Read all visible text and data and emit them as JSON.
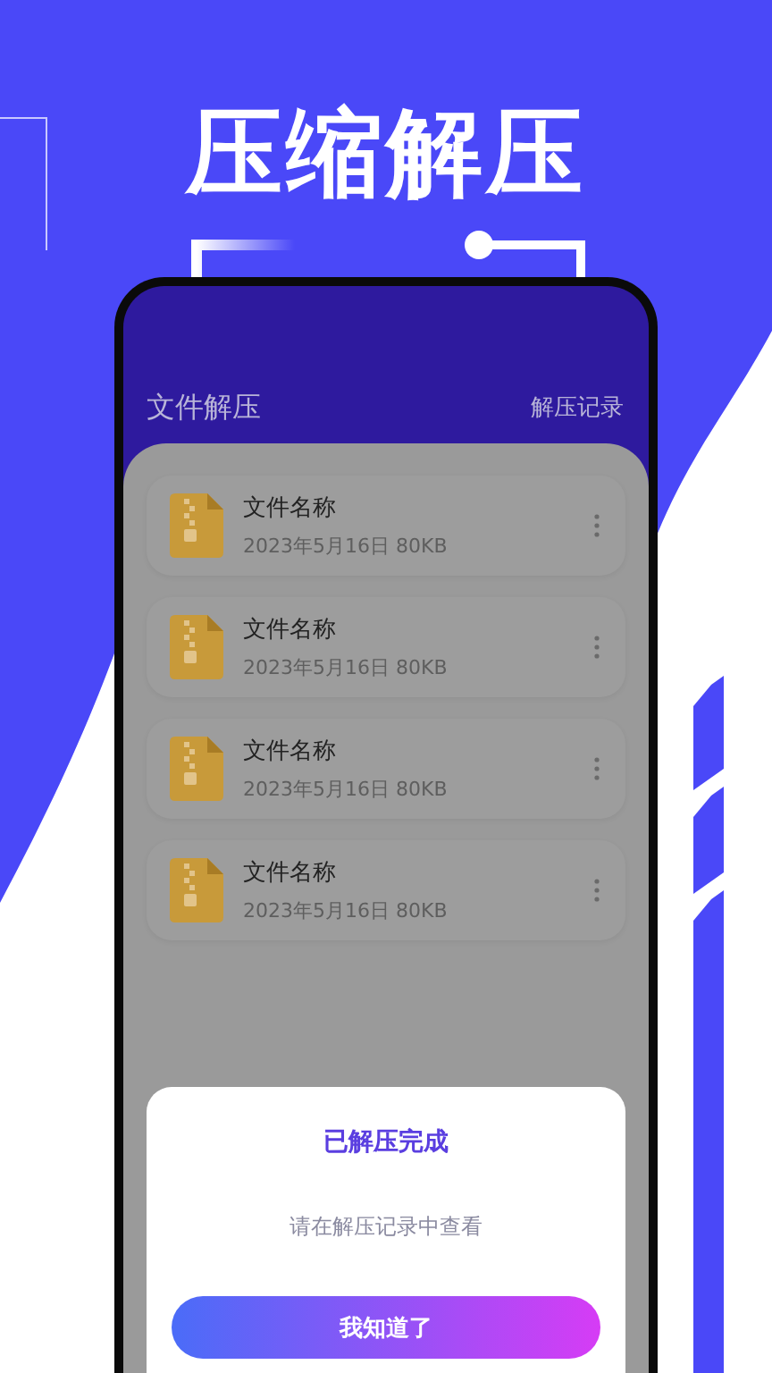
{
  "headline": "压缩解压",
  "app": {
    "title": "文件解压",
    "action": "解压记录",
    "files": [
      {
        "name": "文件名称",
        "date": "2023年5月16日",
        "size": "80KB"
      },
      {
        "name": "文件名称",
        "date": "2023年5月16日",
        "size": "80KB"
      },
      {
        "name": "文件名称",
        "date": "2023年5月16日",
        "size": "80KB"
      },
      {
        "name": "文件名称",
        "date": "2023年5月16日",
        "size": "80KB"
      }
    ]
  },
  "dialog": {
    "title": "已解压完成",
    "message": "请在解压记录中查看",
    "button": "我知道了"
  }
}
